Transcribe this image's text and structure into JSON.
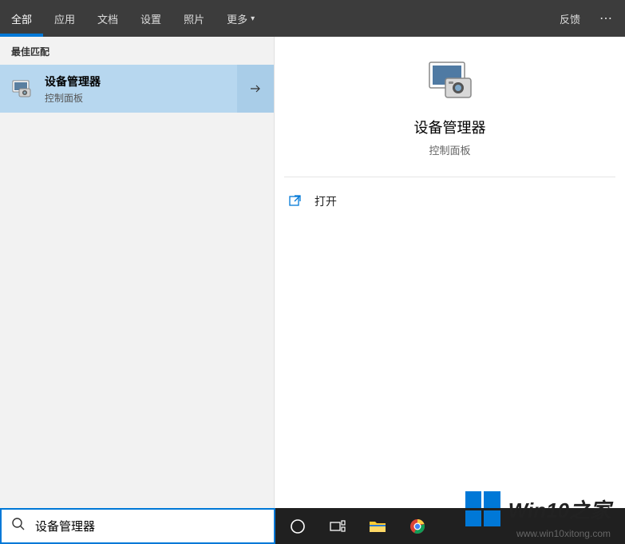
{
  "tabs": {
    "all": "全部",
    "apps": "应用",
    "docs": "文档",
    "settings": "设置",
    "photos": "照片",
    "more": "更多"
  },
  "topRight": {
    "feedback": "反馈"
  },
  "left": {
    "section": "最佳匹配",
    "result": {
      "title": "设备管理器",
      "subtitle": "控制面板"
    }
  },
  "preview": {
    "title": "设备管理器",
    "subtitle": "控制面板"
  },
  "actions": {
    "open": "打开"
  },
  "search": {
    "value": "设备管理器",
    "placeholder": ""
  },
  "watermark": {
    "title": "Win10之家",
    "url": "www.win10xitong.com"
  }
}
